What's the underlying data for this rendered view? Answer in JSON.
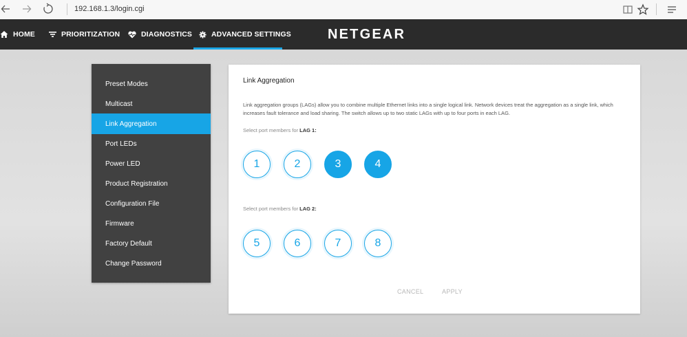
{
  "browser": {
    "url": "192.168.1.3/login.cgi"
  },
  "topnav": {
    "items": [
      {
        "label": "HOME",
        "icon": "home-icon"
      },
      {
        "label": "PRIORITIZATION",
        "icon": "filter-icon"
      },
      {
        "label": "DIAGNOSTICS",
        "icon": "heartbeat-icon"
      },
      {
        "label": "ADVANCED SETTINGS",
        "icon": "gear-icon",
        "active": true
      }
    ],
    "brand": "NETGEAR"
  },
  "sidebar": {
    "items": [
      {
        "label": "Preset Modes"
      },
      {
        "label": "Multicast"
      },
      {
        "label": "Link Aggregation",
        "active": true
      },
      {
        "label": "Port LEDs"
      },
      {
        "label": "Power LED"
      },
      {
        "label": "Product Registration"
      },
      {
        "label": "Configuration File"
      },
      {
        "label": "Firmware"
      },
      {
        "label": "Factory Default"
      },
      {
        "label": "Change Password"
      }
    ]
  },
  "main": {
    "title": "Link Aggregation",
    "description": "Link aggregation groups (LAGs) allow you to combine multiple Ethernet links into a single logical link. Network devices treat the aggregation as a single link, which increases fault tolerance and load sharing. The switch allows up to two static LAGs with up to four ports in each LAG.",
    "lag1": {
      "prompt": "Select port members for ",
      "name": "LAG 1:",
      "ports": [
        {
          "label": "1",
          "selected": false
        },
        {
          "label": "2",
          "selected": false
        },
        {
          "label": "3",
          "selected": true
        },
        {
          "label": "4",
          "selected": true
        }
      ]
    },
    "lag2": {
      "prompt": "Select port members for ",
      "name": "LAG 2:",
      "ports": [
        {
          "label": "5",
          "selected": false
        },
        {
          "label": "6",
          "selected": false
        },
        {
          "label": "7",
          "selected": false
        },
        {
          "label": "8",
          "selected": false
        }
      ]
    },
    "cancel_label": "CANCEL",
    "apply_label": "APPLY"
  },
  "colors": {
    "accent": "#17a5e6",
    "nav_bg": "#2b2b2b",
    "sidebar_bg": "#414141"
  }
}
